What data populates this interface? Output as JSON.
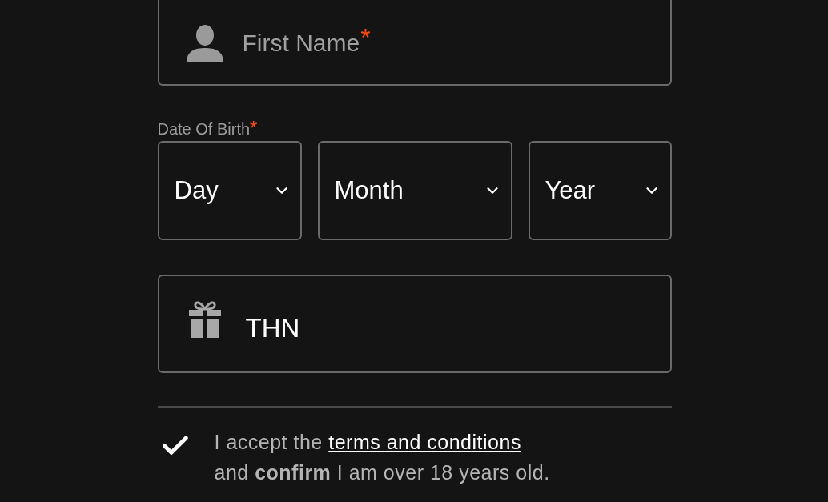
{
  "first_name": {
    "placeholder": "First Name",
    "required_mark": "*"
  },
  "date_of_birth": {
    "label": "Date Of Birth",
    "required_mark": "*",
    "selects": [
      {
        "placeholder": "Day"
      },
      {
        "placeholder": "Month"
      },
      {
        "placeholder": "Year"
      }
    ]
  },
  "promo_code": {
    "value": "THN"
  },
  "terms": {
    "checked": true,
    "prefix": "I accept the",
    "link": "terms and conditions",
    "suffix": "and **confirm** I am over 18 years old."
  }
}
